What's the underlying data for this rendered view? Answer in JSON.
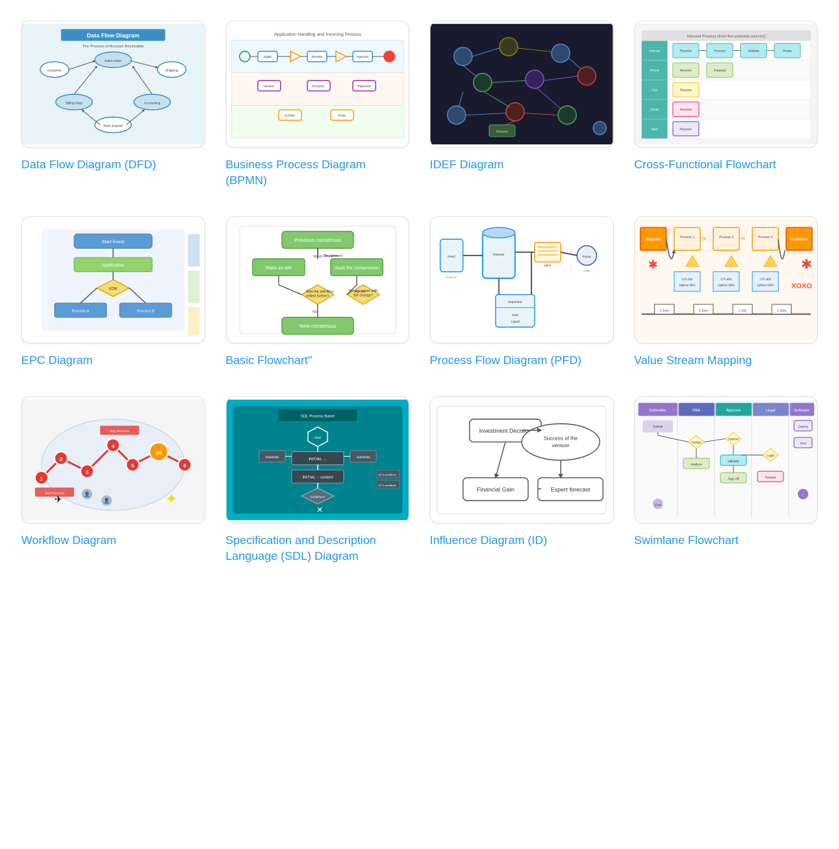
{
  "cards": [
    {
      "id": "data-flow-diagram",
      "label": "Data Flow Diagram (DFD)",
      "thumbnail_type": "dfd"
    },
    {
      "id": "business-process-diagram",
      "label": "Business Process Diagram (BPMN)",
      "thumbnail_type": "bpmn"
    },
    {
      "id": "idef-diagram",
      "label": "IDEF Diagram",
      "thumbnail_type": "idef"
    },
    {
      "id": "cross-functional-flowchart",
      "label": "Cross-Functional Flowchart",
      "thumbnail_type": "cross"
    },
    {
      "id": "epc-diagram",
      "label": "EPC Diagram",
      "thumbnail_type": "epc"
    },
    {
      "id": "basic-flowchart",
      "label": "Basic Flowchart\"",
      "thumbnail_type": "basic"
    },
    {
      "id": "process-flow-diagram",
      "label": "Process Flow Diagram (PFD)",
      "thumbnail_type": "pfd"
    },
    {
      "id": "value-stream-mapping",
      "label": "Value Stream Mapping",
      "thumbnail_type": "vsm"
    },
    {
      "id": "workflow-diagram",
      "label": "Workflow Diagram",
      "thumbnail_type": "workflow"
    },
    {
      "id": "sdl-diagram",
      "label": "Specification and Description Language (SDL) Diagram",
      "thumbnail_type": "sdl"
    },
    {
      "id": "influence-diagram",
      "label": "Influence Diagram (ID)",
      "thumbnail_type": "influence"
    },
    {
      "id": "swimlane-flowchart",
      "label": "Swimlane Flowchart",
      "thumbnail_type": "swimlane"
    }
  ]
}
